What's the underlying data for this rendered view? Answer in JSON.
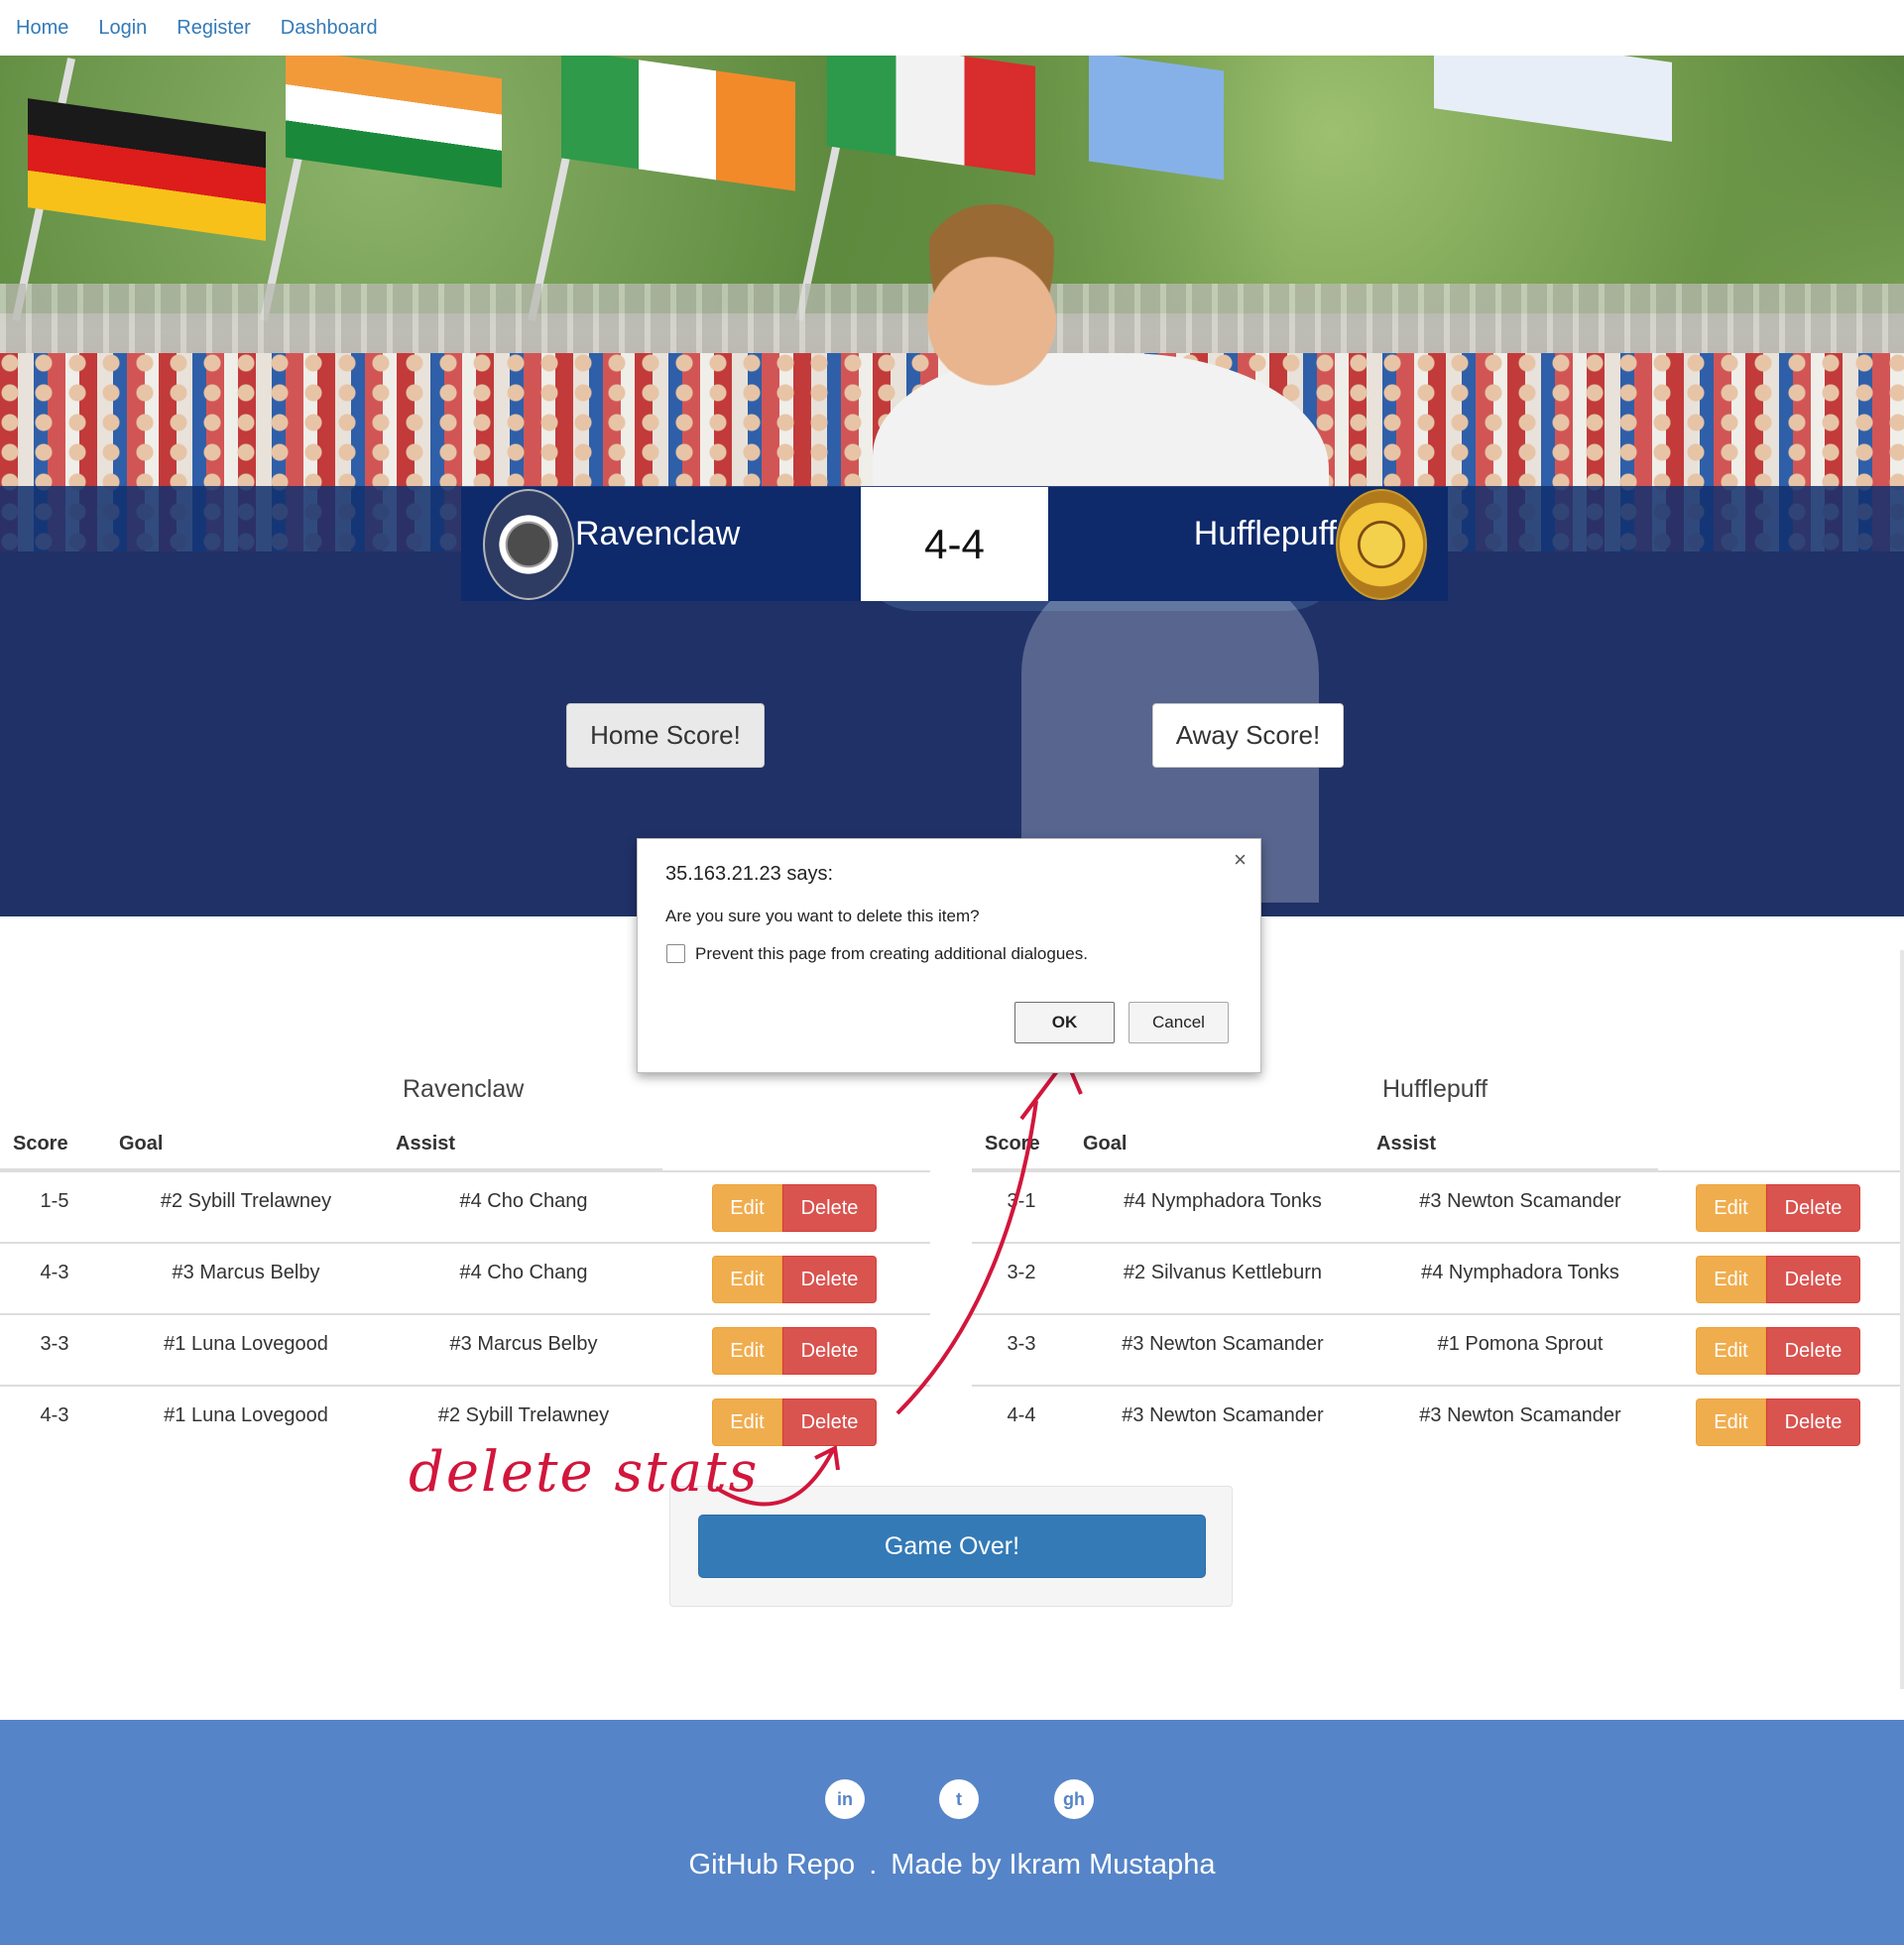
{
  "nav": {
    "items": [
      {
        "label": "Home"
      },
      {
        "label": "Login"
      },
      {
        "label": "Register"
      },
      {
        "label": "Dashboard"
      }
    ]
  },
  "scoreboard": {
    "home_team": "Ravenclaw",
    "away_team": "Hufflepuff",
    "score": "4-4"
  },
  "buttons": {
    "home_score": "Home Score!",
    "away_score": "Away Score!",
    "game_over": "Game Over!",
    "edit": "Edit",
    "delete": "Delete"
  },
  "dialog": {
    "title": "35.163.21.23 says:",
    "message": "Are you sure you want to delete this item?",
    "checkbox_label": "Prevent this page from creating additional dialogues.",
    "ok": "OK",
    "cancel": "Cancel",
    "close_glyph": "×"
  },
  "tables": {
    "home": {
      "title": "Ravenclaw",
      "columns": [
        "Score",
        "Goal",
        "Assist"
      ],
      "rows": [
        {
          "score": "1-5",
          "goal": "#2 Sybill Trelawney",
          "assist": "#4 Cho Chang"
        },
        {
          "score": "4-3",
          "goal": "#3 Marcus Belby",
          "assist": "#4 Cho Chang"
        },
        {
          "score": "3-3",
          "goal": "#1 Luna Lovegood",
          "assist": "#3 Marcus Belby"
        },
        {
          "score": "4-3",
          "goal": "#1 Luna Lovegood",
          "assist": "#2 Sybill Trelawney"
        }
      ]
    },
    "away": {
      "title": "Hufflepuff",
      "columns": [
        "Score",
        "Goal",
        "Assist"
      ],
      "rows": [
        {
          "score": "3-1",
          "goal": "#4 Nymphadora Tonks",
          "assist": "#3 Newton Scamander"
        },
        {
          "score": "3-2",
          "goal": "#2 Silvanus Kettleburn",
          "assist": "#4 Nymphadora Tonks"
        },
        {
          "score": "3-3",
          "goal": "#3 Newton Scamander",
          "assist": "#1 Pomona Sprout"
        },
        {
          "score": "4-4",
          "goal": "#3 Newton Scamander",
          "assist": "#3 Newton Scamander"
        }
      ]
    }
  },
  "annotation": {
    "text": "delete stats",
    "color": "#d2163c"
  },
  "footer": {
    "links": [
      "GitHub Repo",
      "Made by Ikram Mustapha"
    ],
    "separator": ".",
    "icons": [
      "linkedin-icon",
      "twitter-icon",
      "github-icon"
    ],
    "icon_glyphs": [
      "in",
      "t",
      "gh"
    ]
  },
  "colors": {
    "nav_link": "#337ab7",
    "scoreboard_bg": "#0e2a6b",
    "edit": "#f0ad4e",
    "delete": "#d9534f",
    "primary": "#337ab7",
    "footer_bg": "#5584c8"
  }
}
